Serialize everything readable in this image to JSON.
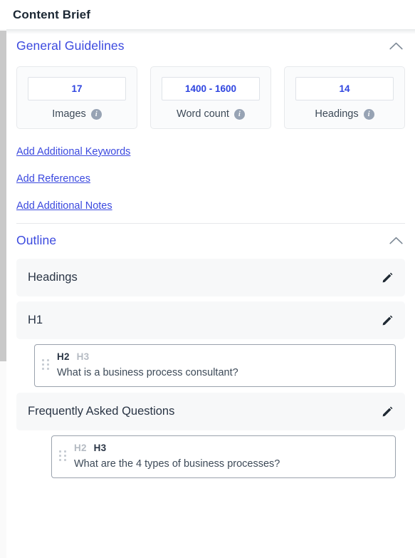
{
  "header": {
    "title": "Content Brief"
  },
  "sections": {
    "general": {
      "label": "General Guidelines",
      "collapse_icon": "chevron-up-icon",
      "cards": [
        {
          "value": "17",
          "caption": "Images",
          "info_icon": "info-icon"
        },
        {
          "value": "1400 - 1600",
          "caption": "Word count",
          "info_icon": "info-icon"
        },
        {
          "value": "14",
          "caption": "Headings",
          "info_icon": "info-icon"
        }
      ],
      "links": [
        "Add Additional Keywords",
        "Add References",
        "Add Additional Notes"
      ]
    },
    "outline": {
      "label": "Outline",
      "collapse_icon": "chevron-up-icon",
      "rows": [
        {
          "text": "Headings",
          "edit_icon": "pencil-icon"
        },
        {
          "text": "H1",
          "edit_icon": "pencil-icon"
        },
        {
          "text": "Frequently Asked Questions",
          "edit_icon": "pencil-icon"
        }
      ],
      "items": [
        {
          "level_options": [
            "H2",
            "H3"
          ],
          "active_level": "H2",
          "text": "What is a business process consultant?",
          "drag_icon": "drag-handle-icon"
        },
        {
          "level_options": [
            "H2",
            "H3"
          ],
          "active_level": "H3",
          "text": "What are the 4 types of business processes?",
          "drag_icon": "drag-handle-icon"
        }
      ]
    }
  },
  "colors": {
    "accent_blue": "#3b49df",
    "value_blue": "#2f45e0",
    "text_dark": "#2a3545",
    "muted": "#b5bbc3",
    "row_bg": "#f7f8f9"
  }
}
